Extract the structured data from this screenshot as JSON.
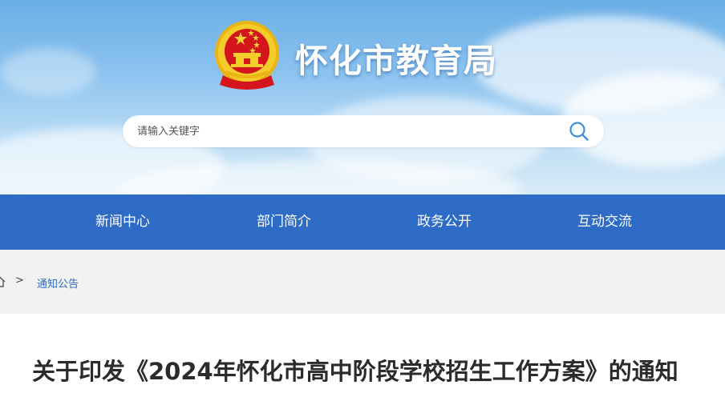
{
  "header": {
    "site_title": "怀化市教育局",
    "emblem_icon": "national-emblem-icon"
  },
  "search": {
    "placeholder": "请输入关键字",
    "value": "",
    "icon": "search-icon"
  },
  "nav": {
    "items": [
      {
        "label": "新闻中心"
      },
      {
        "label": "部门简介"
      },
      {
        "label": "政务公开"
      },
      {
        "label": "互动交流"
      }
    ]
  },
  "breadcrumb": {
    "home_icon": "home-icon",
    "separator": ">",
    "current": "通知公告"
  },
  "article": {
    "title": "关于印发《2024年怀化市高中阶段学校招生工作方案》的通知"
  },
  "colors": {
    "nav_background": "#2d6bc6",
    "breadcrumb_link": "#2d6bc6",
    "breadcrumb_background": "#f2f2f2",
    "emblem_gold": "#f2c21a",
    "emblem_red": "#d4161c"
  }
}
